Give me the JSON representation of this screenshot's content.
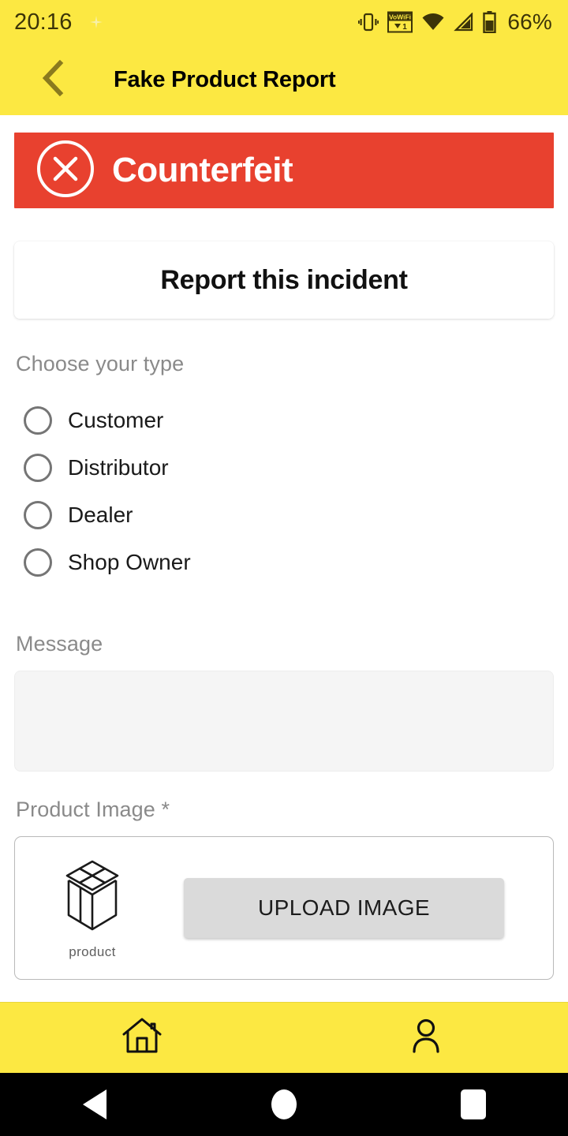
{
  "status_bar": {
    "time": "20:16",
    "battery_percent": "66%",
    "icons": [
      "sparkle-icon",
      "vibrate-icon",
      "vowifi-icon",
      "wifi-icon",
      "cellular-signal-icon",
      "battery-icon"
    ],
    "vowifi_label": "VoWiFi",
    "vowifi_sim": "1"
  },
  "app_bar": {
    "title": "Fake Product Report",
    "back_icon": "chevron-left-icon",
    "background": "#FCE842"
  },
  "banner": {
    "label": "Counterfeit",
    "icon": "circle-x-icon",
    "background": "#E8412F",
    "text_color": "#FFFFFF"
  },
  "report_card": {
    "title": "Report this incident"
  },
  "form": {
    "type_label": "Choose your type",
    "type_options": [
      {
        "label": "Customer",
        "selected": false
      },
      {
        "label": "Distributor",
        "selected": false
      },
      {
        "label": "Dealer",
        "selected": false
      },
      {
        "label": "Shop Owner",
        "selected": false
      }
    ],
    "message_label": "Message",
    "message_value": "",
    "message_placeholder": "",
    "product_image_label": "Product Image *",
    "product_thumb_caption": "product",
    "product_thumb_icon": "product-box-icon",
    "upload_button_label": "UPLOAD IMAGE"
  },
  "bottom_nav": {
    "items": [
      {
        "name": "home",
        "icon": "home-icon"
      },
      {
        "name": "profile",
        "icon": "person-icon"
      }
    ],
    "background": "#FCE842"
  },
  "system_nav": {
    "back_icon": "triangle-back-icon",
    "home_icon": "circle-home-icon",
    "recents_icon": "square-recents-icon"
  }
}
